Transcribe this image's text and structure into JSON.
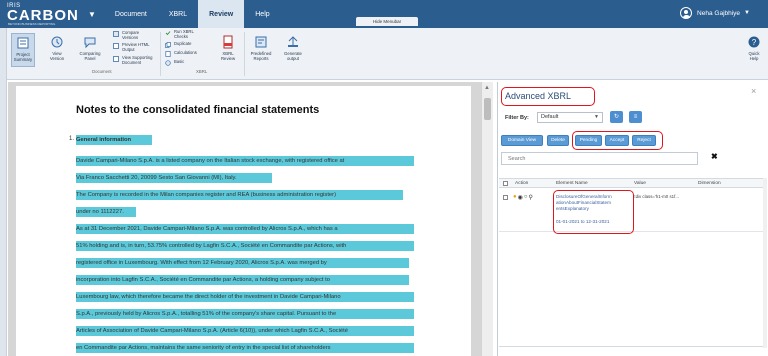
{
  "app": {
    "logo_small": "IRIS",
    "logo_main": "CARBON",
    "logo_tag": "BEYOND BUSINESS REPORTING",
    "hide_ribbon_label": "Hide Menubar"
  },
  "menu": {
    "tabs": [
      {
        "label": "Document"
      },
      {
        "label": "XBRL"
      },
      {
        "label": "Review"
      },
      {
        "label": "Help"
      }
    ],
    "active": "Review"
  },
  "user": {
    "name": "Neha Gajbhiye"
  },
  "ribbon": {
    "project_summary": "Project Summary",
    "view_version": "View Version",
    "comparison": "Comparing Panel",
    "compare_versions": "Compare Versions",
    "preview_html": "Preview HTML Output",
    "view_supporting": "View Supporting Document",
    "group_document": "Document",
    "run_checks": "Run XBRL Checks",
    "duplicate": "Duplicate",
    "calculations": "Calculations",
    "basic": "Basic",
    "xbrl_review": "XBRL Review",
    "predefined_reports": "Predefined Reports",
    "generate_output": "Generate output",
    "group_xbrl": "XBRL",
    "quick_help": "Quick Help"
  },
  "document": {
    "title": "Notes to the consolidated financial statements",
    "bullet": "1.",
    "lines": [
      "General information",
      "Davide Campari-Milano S.p.A. is a listed company on the Italian stock exchange, with registered office at",
      "Via Franco Sacchetti 20, 20099 Sesto San Giovanni (MI), Italy.",
      "The Company is recorded in the Milan companies register and REA (business administration register)",
      "under no 1112227.",
      "As at 31 December 2021, Davide Campari-Milano S.p.A. was controlled by Alicros S.p.A., which has a",
      "51% holding and is, in turn, 53.75% controlled by Lagfin S.C.A., Société en Commandite par Actions, with",
      "registered office in Luxembourg. With effect from 12 February 2020, Alicros S.p.A. was merged by",
      "incorporation into Lagfin S.C.A., Société en Commandite par Actions, a holding company subject to",
      "Luxembourg law, which therefore became the direct holder of the investment in Davide Campari-Milano",
      "S.p.A., previously held by Alicros S.p.A., totalling 51% of the company's share capital. Pursuant to the",
      "Articles of Association of Davide Campari-Milano S.p.A. (Article 6(10)), under which Lagfin S.C.A., Société",
      "en Commandite par Actions, maintains the same seniority of entry in the special list of shareholders"
    ]
  },
  "xbrl_panel": {
    "title": "Advanced XBRL",
    "filter_label": "Filter By:",
    "filter_value": "Default",
    "buttons": {
      "domain_view": "Domain View",
      "delete": "Delete",
      "pending": "Pending",
      "accept": "Accept",
      "reject": "Reject"
    },
    "search_placeholder": "Search",
    "columns": {
      "action": "Action",
      "element_name": "Element Name",
      "value": "Value",
      "dimension": "Dimension"
    },
    "rows": [
      {
        "element_name_lines": [
          "DisclosureOfGeneralInform",
          "ationAboutFinancialStatem",
          "entsExplanatory"
        ],
        "period": "01-01-2021 to 12-31-2021",
        "value": "<div class='h1-m0 s1f..."
      }
    ]
  },
  "colors": {
    "topbar": "#2c5d8f",
    "highlight": "#5bc9d9",
    "annotation_red": "#e0161c",
    "button_blue": "#5b9bd5"
  }
}
